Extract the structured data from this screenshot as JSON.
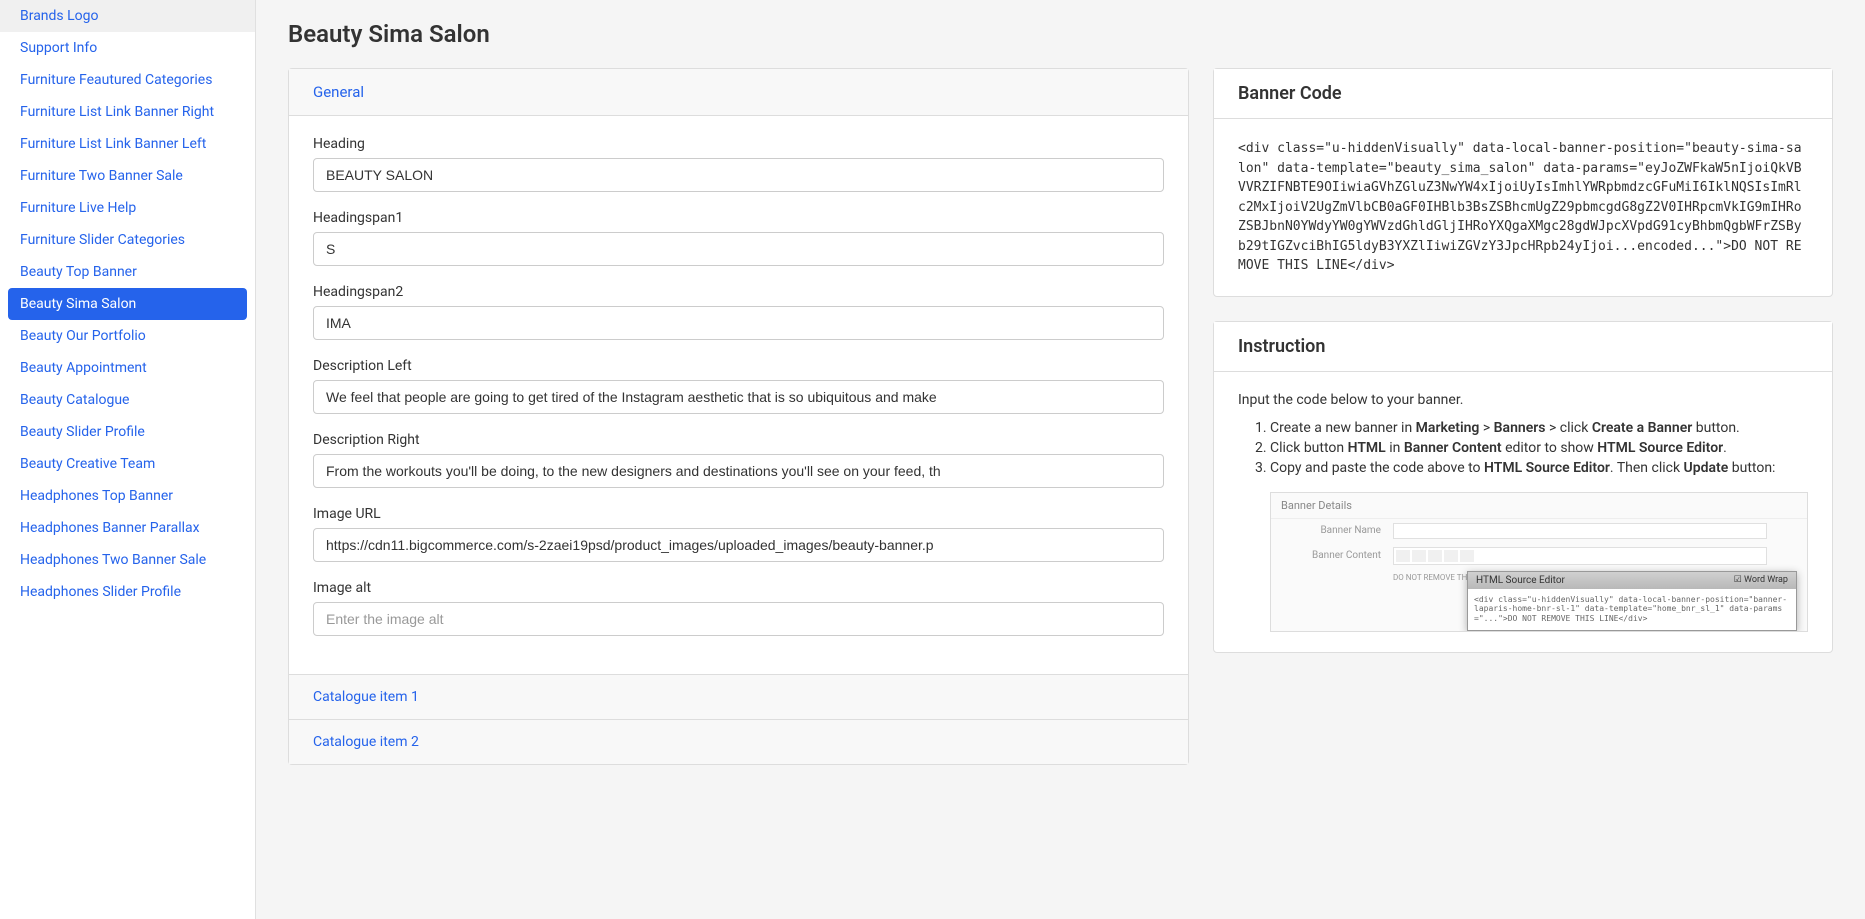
{
  "page": {
    "title": "Beauty Sima Salon"
  },
  "sidebar": {
    "items": [
      "Brands Logo",
      "Support Info",
      "Furniture Feautured Categories",
      "Furniture List Link Banner Right",
      "Furniture List Link Banner Left",
      "Furniture Two Banner Sale",
      "Furniture Live Help",
      "Furniture Slider Categories",
      "Beauty Top Banner",
      "Beauty Sima Salon",
      "Beauty Our Portfolio",
      "Beauty Appointment",
      "Beauty Catalogue",
      "Beauty Slider Profile",
      "Beauty Creative Team",
      "Headphones Top Banner",
      "Headphones Banner Parallax",
      "Headphones Two Banner Sale",
      "Headphones Slider Profile"
    ],
    "activeIndex": 9
  },
  "general": {
    "title": "General",
    "fields": {
      "heading": {
        "label": "Heading",
        "value": "BEAUTY SALON"
      },
      "headingspan1": {
        "label": "Headingspan1",
        "value": "S"
      },
      "headingspan2": {
        "label": "Headingspan2",
        "value": "IMA"
      },
      "descriptionLeft": {
        "label": "Description Left",
        "value": "We feel that people are going to get tired of the Instagram aesthetic that is so ubiquitous and make"
      },
      "descriptionRight": {
        "label": "Description Right",
        "value": "From the workouts you'll be doing, to the new designers and destinations you'll see on your feed, th"
      },
      "imageUrl": {
        "label": "Image URL",
        "value": "https://cdn11.bigcommerce.com/s-2zaei19psd/product_images/uploaded_images/beauty-banner.p"
      },
      "imageAlt": {
        "label": "Image alt",
        "value": "",
        "placeholder": "Enter the image alt"
      }
    }
  },
  "accordion": {
    "item1": "Catalogue item 1",
    "item2": "Catalogue item 2"
  },
  "bannerCode": {
    "title": "Banner Code",
    "content": "<div class=\"u-hiddenVisually\" data-local-banner-position=\"beauty-sima-salon\" data-template=\"beauty_sima_salon\" data-params=\"eyJoZWFkaW5nIjoiQkVBVVRZIFNBTE9OIiwiaGVhZGluZ3NwYW4xIjoiUyIsImhlYWRpbmdzcGFuMiI6IklNQSIsImRlc2MxIjoiV2UgZmVlbCB0aGF0IHBlb3BsZSBhcmUgZ29pbmcgdG8gZ2V0IHRpcmVkIG9mIHRoZSBJbnN0YWdyYW0gYWVzdGhldGljIHRoYXQgaXMgc28gdWJpcXVpdG91cyBhbmQgbWFrZSByb29tIGZvciBhIG5ldyB3YXZlIiwiZGVzY3JpcHRpb24yIjoi...encoded...\">DO NOT REMOVE THIS LINE</div>"
  },
  "instruction": {
    "title": "Instruction",
    "intro": "Input the code below to your banner.",
    "steps": [
      {
        "pre": "Create a new banner in ",
        "b1": "Marketing",
        "mid1": " > ",
        "b2": "Banners",
        "mid2": " > click ",
        "b3": "Create a Banner",
        "post": " button."
      },
      {
        "pre": "Click button ",
        "b1": "HTML",
        "mid1": " in ",
        "b2": "Banner Content",
        "mid2": " editor to show ",
        "b3": "HTML Source Editor",
        "post": "."
      },
      {
        "pre": "Copy and paste the code above to ",
        "b1": "HTML Source Editor",
        "mid1": ". Then click ",
        "b2": "Update",
        "post": " button:"
      }
    ],
    "mock": {
      "header": "Banner Details",
      "nameLabel": "Banner Name",
      "contentLabel": "Banner Content",
      "hint": "DO NOT REMOVE THIS LINE",
      "dialogTitle": "HTML Source Editor",
      "wordWrap": "Word Wrap",
      "dialogSnippet": "<div class=\"u-hiddenVisually\" data-local-banner-position=\"banner-laparis-home-bnr-sl-1\" data-template=\"home_bnr_sl_1\" data-params=\"...\">DO NOT REMOVE THIS LINE</div>"
    }
  }
}
